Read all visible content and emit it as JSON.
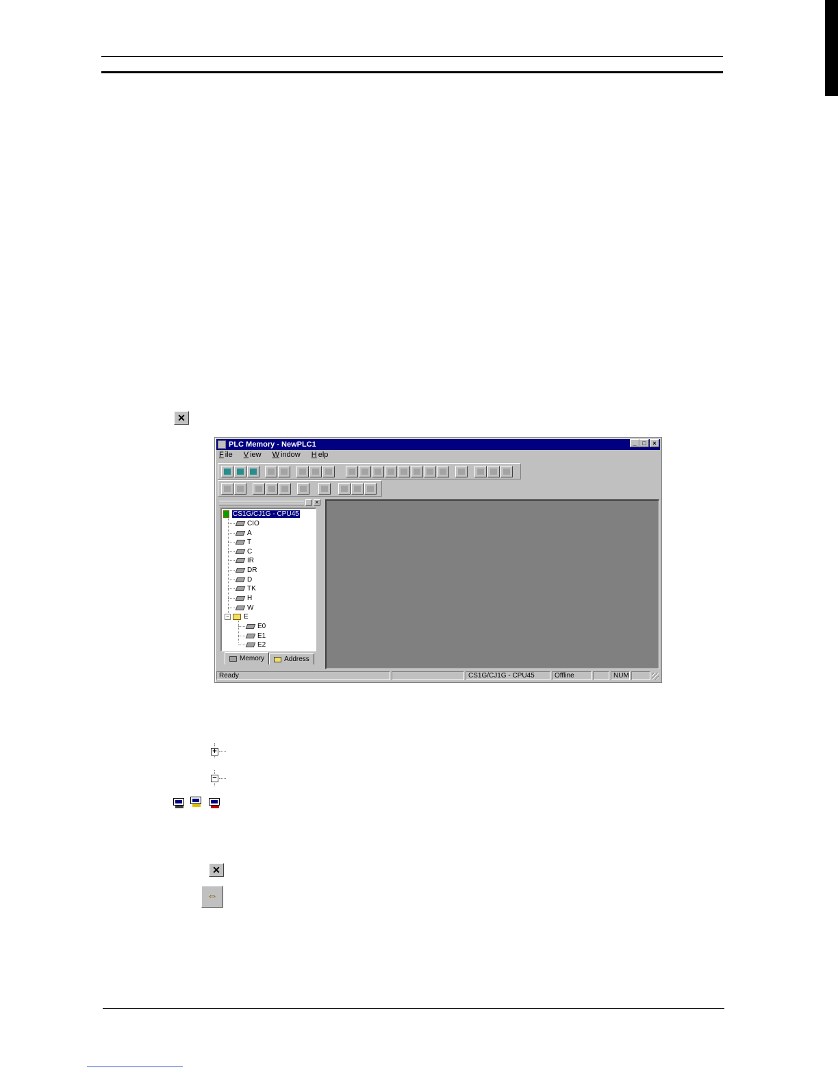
{
  "window": {
    "title": "PLC Memory - NewPLC1",
    "controls": [
      "_",
      "□",
      "×"
    ]
  },
  "menu": [
    {
      "label": "File",
      "accel": "F",
      "rest": "ile"
    },
    {
      "label": "View",
      "accel": "V",
      "rest": "iew"
    },
    {
      "label": "Window",
      "accel": "W",
      "rest": "indow"
    },
    {
      "label": "Help",
      "accel": "H",
      "rest": "elp"
    }
  ],
  "tree": {
    "root": "CS1G/CJ1G - CPU45",
    "areas": [
      "CIO",
      "A",
      "T",
      "C",
      "IR",
      "DR",
      "D",
      "TK",
      "H",
      "W"
    ],
    "folder": "E",
    "folder_children": [
      "E0",
      "E1",
      "E2"
    ]
  },
  "tabs": {
    "memory": "Memory",
    "address": "Address"
  },
  "status": {
    "ready": "Ready",
    "device": "CS1G/CJ1G - CPU45",
    "mode": "Offline",
    "num": "NUM"
  },
  "icons": {
    "close": "close-x-icon",
    "expand": "tree-expand-icon",
    "collapse": "tree-collapse-icon",
    "connection": "pc-connection-icons",
    "close_button": "close-x-icon",
    "layout": "horizontal-layout-icon"
  },
  "glyphs": {
    "x": "✕",
    "plus": "+",
    "minus": "−",
    "layout": "⇔"
  }
}
